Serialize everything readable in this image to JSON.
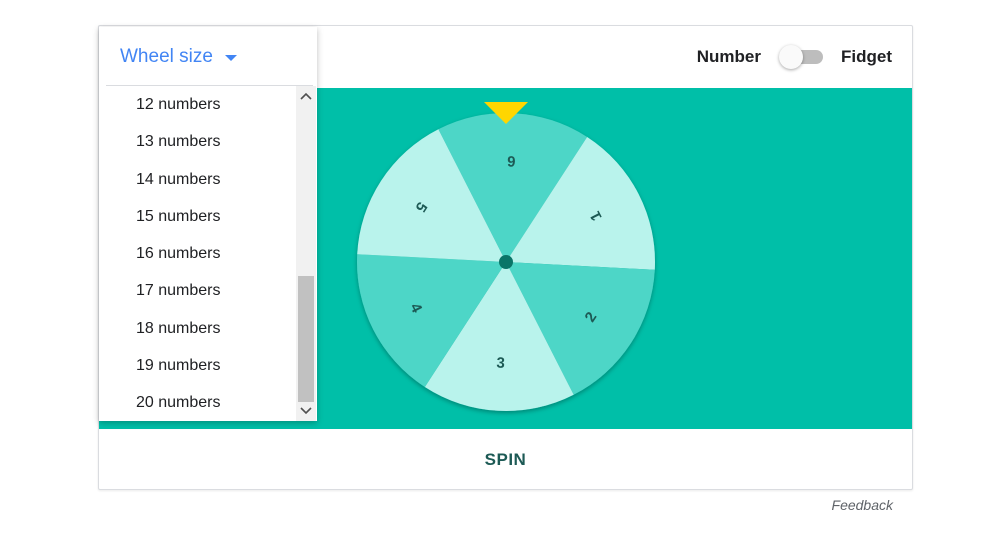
{
  "colors": {
    "stage_bg": "#00bfa8",
    "segment_dark": "#4dd6c7",
    "segment_light": "#b9f3ec",
    "segment_text": "#1d5a55",
    "hub": "#0a7568",
    "pointer": "#ffd600",
    "accent_blue": "#4285f4",
    "spin_text": "#1d5a55"
  },
  "header": {
    "toggle_left_label": "Number",
    "toggle_right_label": "Fidget"
  },
  "dropdown": {
    "label": "Wheel size",
    "caret_icon": "caret-down-icon",
    "items": [
      "12 numbers",
      "13 numbers",
      "14 numbers",
      "15 numbers",
      "16 numbers",
      "17 numbers",
      "18 numbers",
      "19 numbers",
      "20 numbers"
    ],
    "scroll_up_icon": "chevron-up-icon",
    "scroll_down_icon": "chevron-down-icon"
  },
  "wheel": {
    "segments": [
      "6",
      "1",
      "2",
      "3",
      "4",
      "5"
    ],
    "pointer_icon": "triangle-pointer-icon"
  },
  "footer": {
    "spin_label": "SPIN"
  },
  "feedback_label": "Feedback"
}
